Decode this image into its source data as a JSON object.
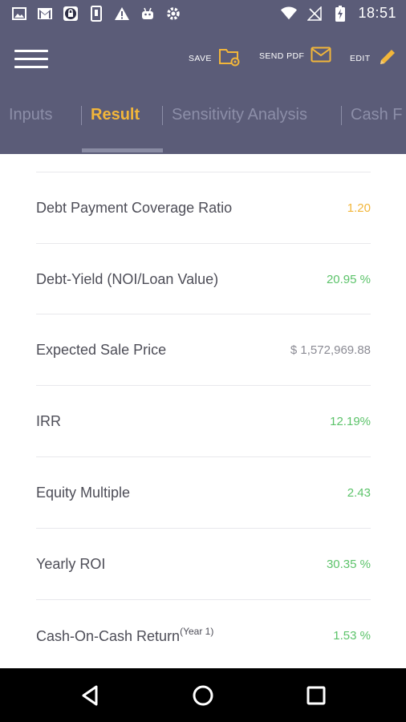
{
  "status_bar": {
    "time": "18:51"
  },
  "app_bar": {
    "save_label": "SAVE",
    "send_pdf_label": "SEND PDF",
    "edit_label": "EDIT",
    "accent": "#f2b63a",
    "background": "#5b5c78"
  },
  "tabs": [
    {
      "label": "Inputs"
    },
    {
      "label": "Result"
    },
    {
      "label": "Sensitivity Analysis"
    },
    {
      "label": "Cash F"
    }
  ],
  "active_tab": "Result",
  "results": [
    {
      "label": "Debt Payment Coverage Ratio",
      "value": "1.20"
    },
    {
      "label": "Debt-Yield (NOI/Loan Value)",
      "value": "20.95 %"
    },
    {
      "label": "Expected Sale Price",
      "value": "$ 1,572,969.88"
    },
    {
      "label": "IRR",
      "value": "12.19%"
    },
    {
      "label": "Equity Multiple",
      "value": "2.43"
    },
    {
      "label": "Yearly ROI",
      "value": "30.35 %"
    },
    {
      "label": "Cash-On-Cash Return",
      "label_sup": "(Year 1)",
      "value": "1.53 %"
    }
  ],
  "colors": {
    "green": "#5cc36a",
    "orange": "#f2b63a",
    "grey": "#8b8b94"
  },
  "icons": [
    "image-icon",
    "gmail-icon",
    "vpn-lock-icon",
    "phone-icon",
    "warning-icon",
    "android-icon",
    "settings-gear-icon",
    "wifi-icon",
    "no-signal-icon",
    "battery-charging-icon",
    "folder-settings-icon",
    "mail-icon",
    "pencil-icon",
    "back-icon",
    "home-icon",
    "recents-icon"
  ]
}
